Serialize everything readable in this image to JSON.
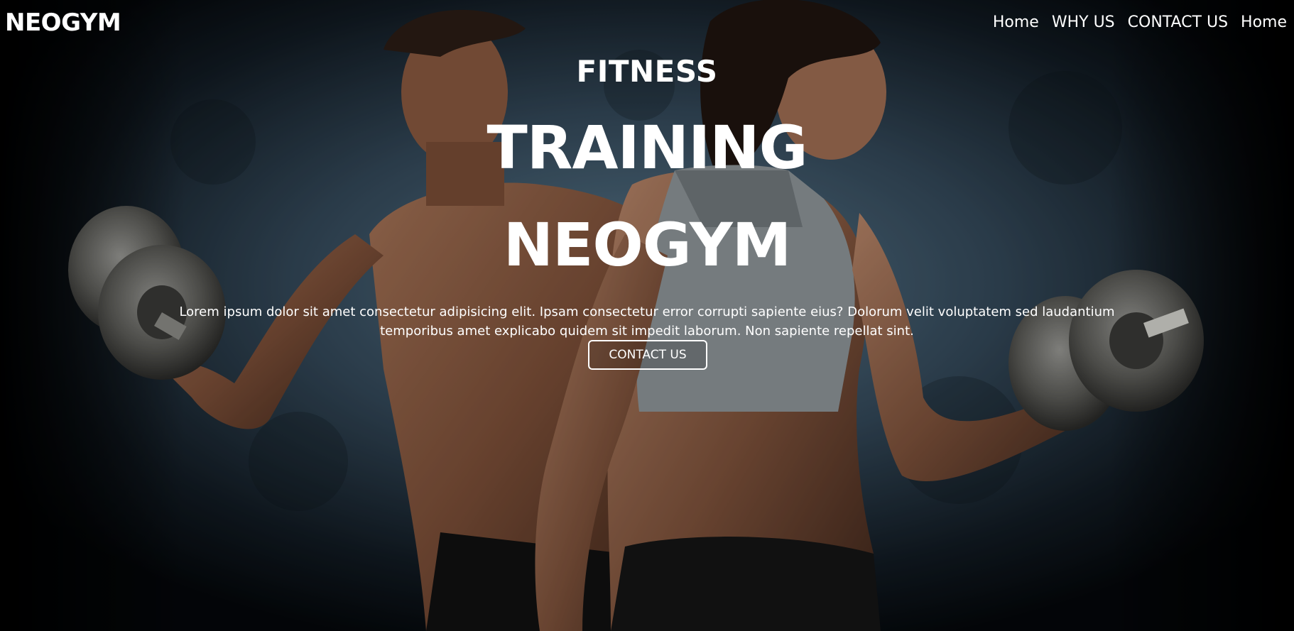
{
  "brand": {
    "logo": "NEOGYM"
  },
  "nav": {
    "items": [
      {
        "label": "Home"
      },
      {
        "label": "WHY US"
      },
      {
        "label": "CONTACT US"
      },
      {
        "label": "Home"
      }
    ]
  },
  "hero": {
    "eyebrow": "FITNESS",
    "title_line1": "TRAINING",
    "title_line2": "NEOGYM",
    "description": "Lorem ipsum dolor sit amet consectetur adipisicing elit. Ipsam consectetur error corrupti sapiente eius? Dolorum velit voluptatem sed laudantium temporibus amet explicabo quidem sit impedit laborum. Non sapiente repellat sint.",
    "cta_label": "CONTACT US",
    "background_image": "gym-athletes-with-dumbbells"
  },
  "colors": {
    "text": "#ffffff",
    "background": "#05080b",
    "wall": "#4a6678"
  }
}
